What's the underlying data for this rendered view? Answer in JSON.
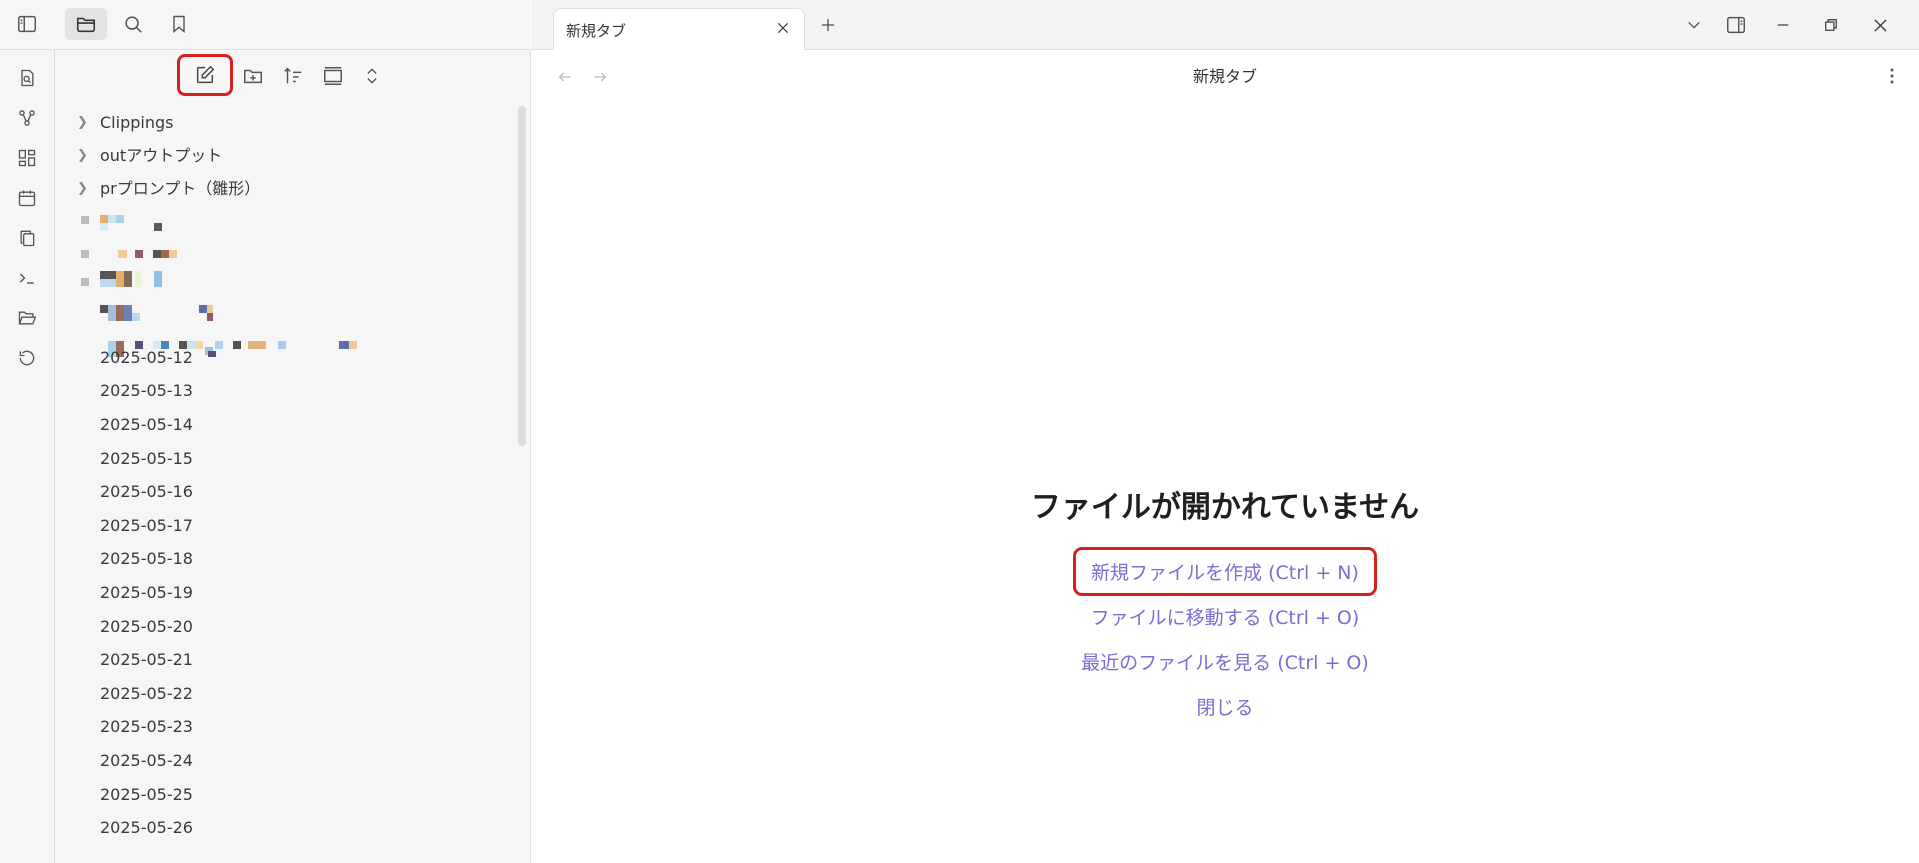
{
  "window": {
    "tab_label": "新規タブ",
    "view_title": "新規タブ"
  },
  "sidebar": {
    "top_icons": [
      "sidebar-toggle-icon",
      "folder-icon",
      "search-icon",
      "bookmark-icon"
    ],
    "toolbar_icons": [
      "new-note-icon",
      "new-folder-icon",
      "sort-icon",
      "collapse-view-icon",
      "expand-collapse-icon"
    ],
    "tree": {
      "folders": [
        "Clippings",
        "outアウトプット",
        "prプロンプト（雛形）"
      ],
      "files": [
        "2025-05-12",
        "2025-05-13",
        "2025-05-14",
        "2025-05-15",
        "2025-05-16",
        "2025-05-17",
        "2025-05-18",
        "2025-05-19",
        "2025-05-20",
        "2025-05-21",
        "2025-05-22",
        "2025-05-23",
        "2025-05-24",
        "2025-05-25",
        "2025-05-26"
      ]
    }
  },
  "ribbon": {
    "icons": [
      "quick-switcher-icon",
      "graph-view-icon",
      "canvas-icon",
      "daily-note-icon",
      "templates-icon",
      "command-palette-icon",
      "open-vault-icon",
      "history-icon"
    ]
  },
  "empty_state": {
    "title": "ファイルが開かれていません",
    "actions": [
      "新規ファイルを作成 (Ctrl + N)",
      "ファイルに移動する (Ctrl + O)",
      "最近のファイルを見る (Ctrl + O)",
      "閉じる"
    ]
  }
}
